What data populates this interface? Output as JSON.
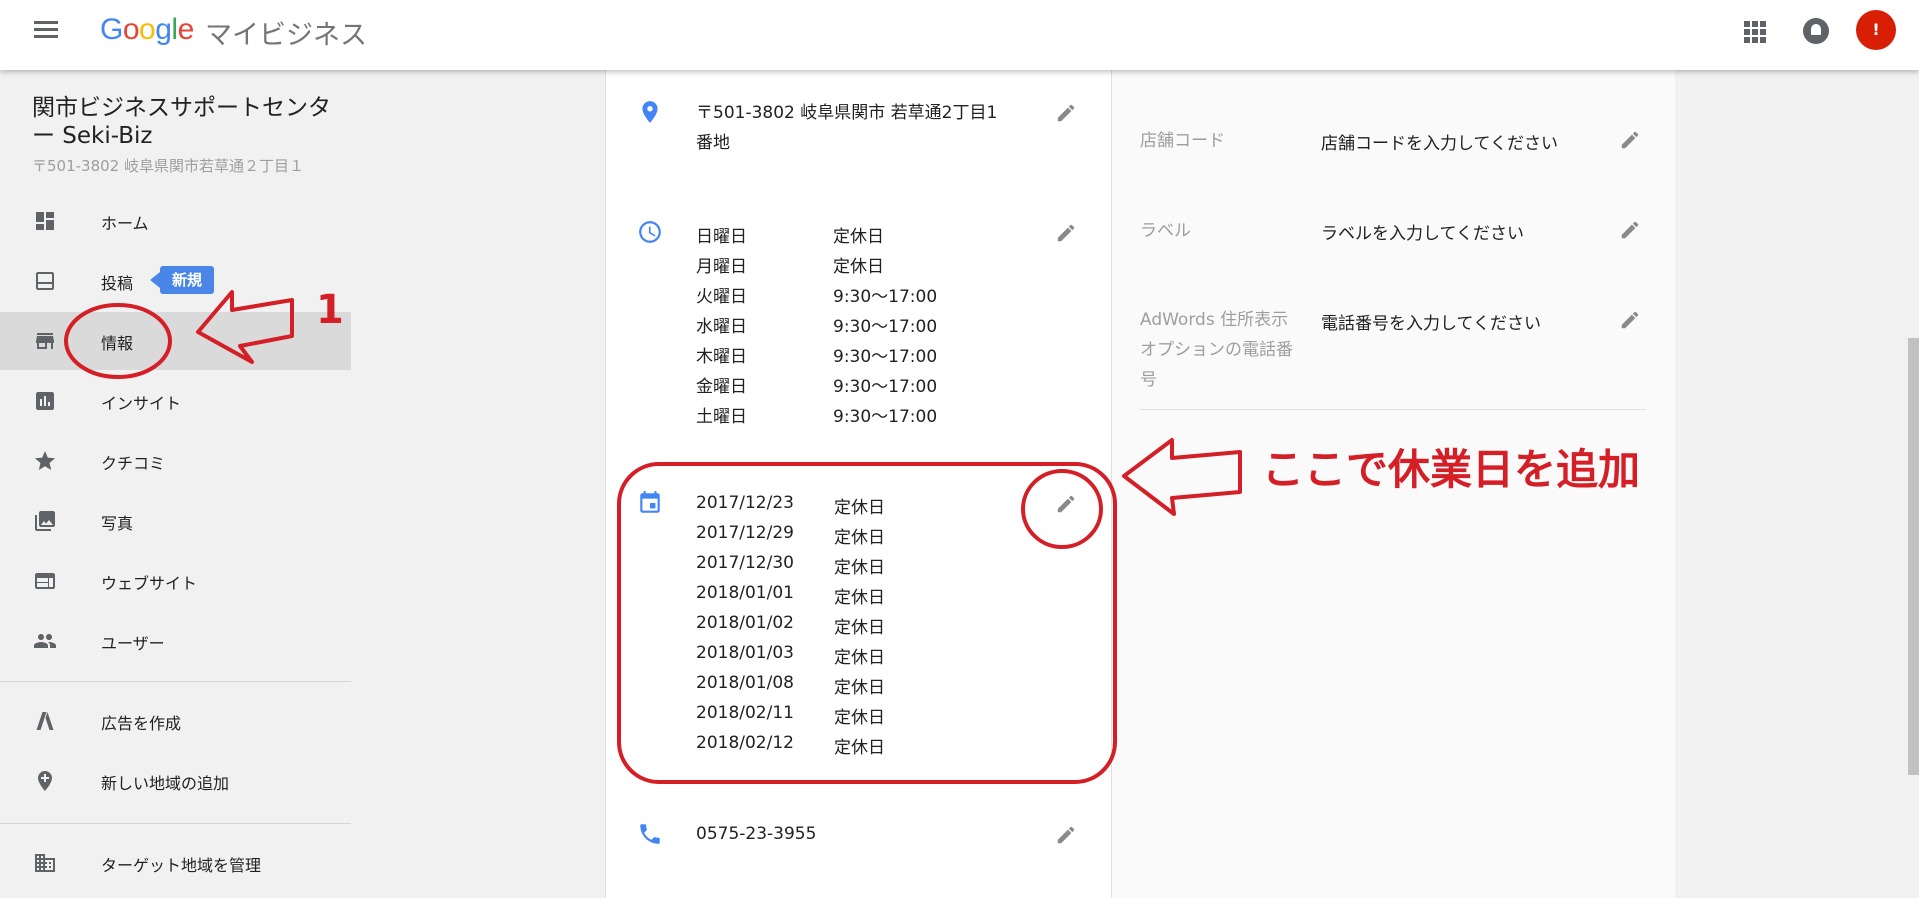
{
  "header": {
    "logo_letters": [
      "G",
      "o",
      "o",
      "g",
      "l",
      "e"
    ],
    "logo_colors": [
      "#4285f4",
      "#ea4335",
      "#fbbc05",
      "#4285f4",
      "#34a853",
      "#ea4335"
    ],
    "product_name": "マイビジネス",
    "avatar_text": "!"
  },
  "business": {
    "name": "関市ビジネスサポートセンター Seki-Biz",
    "address": "〒501-3802 岐阜県関市若草通２丁目１"
  },
  "sidebar": {
    "items": [
      {
        "label": "ホーム",
        "icon": "dashboard-icon"
      },
      {
        "label": "投稿",
        "icon": "post-icon",
        "badge": "新規"
      },
      {
        "label": "情報",
        "icon": "store-icon",
        "active": true
      },
      {
        "label": "インサイト",
        "icon": "insights-icon"
      },
      {
        "label": "クチコミ",
        "icon": "star-icon"
      },
      {
        "label": "写真",
        "icon": "photo-icon"
      },
      {
        "label": "ウェブサイト",
        "icon": "website-icon"
      },
      {
        "label": "ユーザー",
        "icon": "users-icon"
      },
      {
        "label": "広告を作成",
        "icon": "adwords-icon"
      },
      {
        "label": "新しい地域の追加",
        "icon": "add-location-icon"
      },
      {
        "label": "ターゲット地域を管理",
        "icon": "building-icon"
      }
    ]
  },
  "info": {
    "address_line1": "〒501-3802 岐阜県関市 若草通2丁目1",
    "address_line2": "番地",
    "hours": [
      {
        "day": "日曜日",
        "time": "定休日"
      },
      {
        "day": "月曜日",
        "time": "定休日"
      },
      {
        "day": "火曜日",
        "time": "9:30～17:00"
      },
      {
        "day": "水曜日",
        "time": "9:30～17:00"
      },
      {
        "day": "木曜日",
        "time": "9:30～17:00"
      },
      {
        "day": "金曜日",
        "time": "9:30～17:00"
      },
      {
        "day": "土曜日",
        "time": "9:30～17:00"
      }
    ],
    "special_hours": [
      {
        "date": "2017/12/23",
        "status": "定休日"
      },
      {
        "date": "2017/12/29",
        "status": "定休日"
      },
      {
        "date": "2017/12/30",
        "status": "定休日"
      },
      {
        "date": "2018/01/01",
        "status": "定休日"
      },
      {
        "date": "2018/01/02",
        "status": "定休日"
      },
      {
        "date": "2018/01/03",
        "status": "定休日"
      },
      {
        "date": "2018/01/08",
        "status": "定休日"
      },
      {
        "date": "2018/02/11",
        "status": "定休日"
      },
      {
        "date": "2018/02/12",
        "status": "定休日"
      }
    ],
    "phone": "0575-23-3955"
  },
  "side_fields": [
    {
      "label": "店舗コード",
      "value": "店舗コードを入力してください"
    },
    {
      "label": "ラベル",
      "value": "ラベルを入力してください"
    },
    {
      "label": "AdWords 住所表示オプションの電話番号",
      "value": "電話番号を入力してください"
    }
  ],
  "annotations": {
    "step_number": "1",
    "callout": "ここで休業日を追加",
    "color": "#d41f27"
  }
}
